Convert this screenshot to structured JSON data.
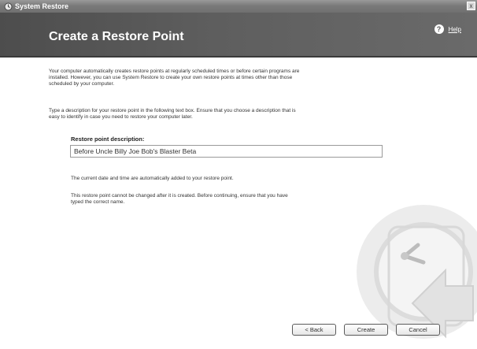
{
  "window": {
    "title": "System Restore",
    "close_glyph": "x"
  },
  "header": {
    "title": "Create a Restore Point",
    "help_icon_glyph": "?",
    "help_label": "Help"
  },
  "content": {
    "intro": "Your computer automatically creates restore points at regularly scheduled times or before certain programs are\ninstalled. However, you can use System Restore to create your own restore points at times other than those\nscheduled by your computer.",
    "instructions": "Type a description for your restore point in the following text box. Ensure that you choose a description that is\neasy to identify in case you need to restore your computer later.",
    "field_label": "Restore point description:",
    "field_value": "Before Uncle Billy Joe Bob's Blaster Beta",
    "datetime_note": "The current date and time are automatically added to your restore point.",
    "warning": "This restore point cannot be changed after it is created. Before continuing, ensure that you have\ntyped the correct name."
  },
  "buttons": {
    "back": "< Back",
    "create": "Create",
    "cancel": "Cancel"
  },
  "icons": [
    "system-restore-icon",
    "help-icon",
    "close-icon",
    "clock-arrow-graphic"
  ]
}
